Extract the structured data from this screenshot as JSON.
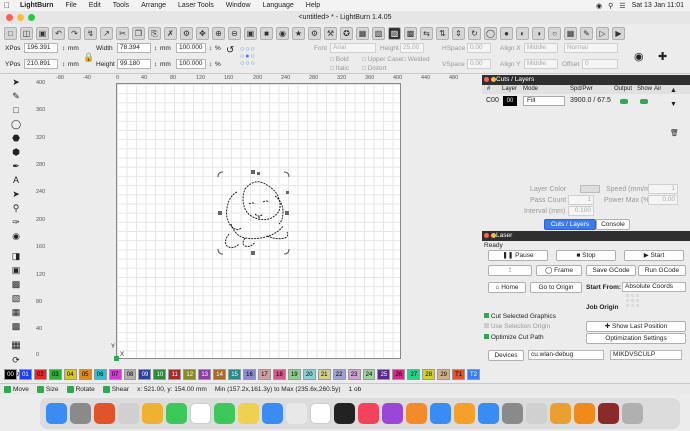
{
  "menubar": {
    "app": "LightBurn",
    "items": [
      "File",
      "Edit",
      "Tools",
      "Arrange",
      "Laser Tools",
      "Window",
      "Language",
      "Help"
    ],
    "datetime": "Sat 13 Jan  11:01"
  },
  "window": {
    "title": "<untitled> * - LightBurn 1.4.05"
  },
  "props": {
    "xpos_label": "XPos",
    "xpos_value": "196.391",
    "xpos_unit": "mm",
    "ypos_label": "YPos",
    "ypos_value": "210.891",
    "ypos_unit": "mm",
    "width_label": "Width",
    "width_value": "78.394",
    "width_unit": "mm",
    "width_pct": "100.000",
    "pct_unit": "%",
    "height_label": "Height",
    "height_value": "99.180",
    "height_unit": "mm",
    "height_pct": "100.000",
    "font_label": "Font",
    "font_value": "Arial",
    "fheight_label": "Height",
    "fheight_value": "25.00",
    "hspace_label": "HSpace",
    "hspace_value": "0.00",
    "vspace_label": "VSpace",
    "vspace_value": "0.00",
    "alignx_label": "Align X",
    "alignx_value": "Middle",
    "aligny_label": "Align Y",
    "aligny_value": "Middle",
    "style_value": "Normal",
    "offset_label": "Offset",
    "offset_value": "0",
    "bold": "Bold",
    "italic": "Italic",
    "upper_case": "Upper Case",
    "distort": "Distort",
    "welded": "Welded"
  },
  "ruler": {
    "top": [
      "-80",
      "-40",
      "0",
      "40",
      "80",
      "120",
      "160",
      "200",
      "240",
      "280",
      "320",
      "360",
      "400",
      "440",
      "480"
    ],
    "left": [
      "400",
      "360",
      "320",
      "280",
      "240",
      "200",
      "160",
      "120",
      "80",
      "40",
      "0"
    ]
  },
  "canvas_labels": {
    "y_marker": "Y",
    "x_marker": "X"
  },
  "palette": [
    {
      "label": "00",
      "color": "#000000",
      "text": "#ffffff"
    },
    {
      "label": "01",
      "color": "#1f3fff",
      "text": "#ffffff"
    },
    {
      "label": "02",
      "color": "#e22a2a",
      "text": "#000000"
    },
    {
      "label": "03",
      "color": "#2fae3b",
      "text": "#000000"
    },
    {
      "label": "04",
      "color": "#d8c81f",
      "text": "#000000"
    },
    {
      "label": "05",
      "color": "#e08a1a",
      "text": "#000000"
    },
    {
      "label": "06",
      "color": "#2fc0d0",
      "text": "#000000"
    },
    {
      "label": "07",
      "color": "#d23bd2",
      "text": "#000000"
    },
    {
      "label": "08",
      "color": "#b0b0b0",
      "text": "#000000"
    },
    {
      "label": "09",
      "color": "#2a3fa8",
      "text": "#ffffff"
    },
    {
      "label": "10",
      "color": "#2f8a3a",
      "text": "#ffffff"
    },
    {
      "label": "11",
      "color": "#a82a2a",
      "text": "#ffffff"
    },
    {
      "label": "12",
      "color": "#8a8a2a",
      "text": "#ffffff"
    },
    {
      "label": "13",
      "color": "#8a3fa8",
      "text": "#ffffff"
    },
    {
      "label": "14",
      "color": "#a86a2a",
      "text": "#ffffff"
    },
    {
      "label": "15",
      "color": "#2a8a8a",
      "text": "#ffffff"
    },
    {
      "label": "16",
      "color": "#8a8ad0",
      "text": "#000000"
    },
    {
      "label": "17",
      "color": "#d0a0a0",
      "text": "#000000"
    },
    {
      "label": "18",
      "color": "#d05a8a",
      "text": "#000000"
    },
    {
      "label": "19",
      "color": "#8ad08a",
      "text": "#000000"
    },
    {
      "label": "20",
      "color": "#8ad0d0",
      "text": "#000000"
    },
    {
      "label": "21",
      "color": "#d0d08a",
      "text": "#000000"
    },
    {
      "label": "22",
      "color": "#a0a0d0",
      "text": "#000000"
    },
    {
      "label": "23",
      "color": "#d0a0d0",
      "text": "#000000"
    },
    {
      "label": "24",
      "color": "#a0d0a0",
      "text": "#000000"
    },
    {
      "label": "25",
      "color": "#5a2a8a",
      "text": "#ffffff"
    },
    {
      "label": "26",
      "color": "#d02a8a",
      "text": "#000000"
    },
    {
      "label": "27",
      "color": "#2ad08a",
      "text": "#000000"
    },
    {
      "label": "28",
      "color": "#d0d02a",
      "text": "#000000"
    },
    {
      "label": "29",
      "color": "#d0b08a",
      "text": "#000000"
    },
    {
      "label": "T1",
      "color": "#e2532a",
      "text": "#000000"
    },
    {
      "label": "T2",
      "color": "#3b7cf5",
      "text": "#ffffff"
    }
  ],
  "status": {
    "move": "Move",
    "size": "Size",
    "rotate": "Rotate",
    "shear": "Shear",
    "coords": "x: 521.00, y: 154.00 mm",
    "range": "Min (157.2x,161.3y) to Max (235.6x,260.5y)",
    "objects": "1 ob"
  },
  "cuts": {
    "header": "Cuts / Layers",
    "col_num": "#",
    "col_layer": "Layer",
    "col_mode": "Mode",
    "col_spd": "Spd/Pwr",
    "col_output": "Output",
    "col_show": "Show",
    "col_air": "Air",
    "row": {
      "num": "C00",
      "layer": "00",
      "mode": "Fill",
      "spd": "3900.0 / 67.5"
    },
    "layer_color_label": "Layer Color",
    "speed_label": "Speed (mm/m)",
    "speed_value": "1",
    "pass_label": "Pass Count",
    "pass_value": "1",
    "power_label": "Power Max (%)",
    "power_value": "0.00",
    "interval_label": "Interval (mm)",
    "interval_value": "0.100",
    "tab_cuts": "Cuts / Layers",
    "tab_console": "Console"
  },
  "laser": {
    "header": "Laser",
    "status": "Ready",
    "pause": "Pause",
    "stop": "Stop",
    "start": "Start",
    "frame": "Frame",
    "save_gcode": "Save GCode",
    "run_gcode": "Run GCode",
    "home": "Home",
    "go_to_origin": "Go to Origin",
    "start_from_label": "Start From:",
    "start_from_value": "Absolute Coords",
    "job_origin_label": "Job Origin",
    "cut_selected": "Cut Selected Graphics",
    "use_selection_origin": "Use Selection Origin",
    "optimize_cut": "Optimize Cut Path",
    "show_last_position": "Show Last Position",
    "optimization_settings": "Optimization Settings",
    "devices": "Devices",
    "device_port": "cu.wlan-debug",
    "device_name": "MIKDVSCULP"
  }
}
